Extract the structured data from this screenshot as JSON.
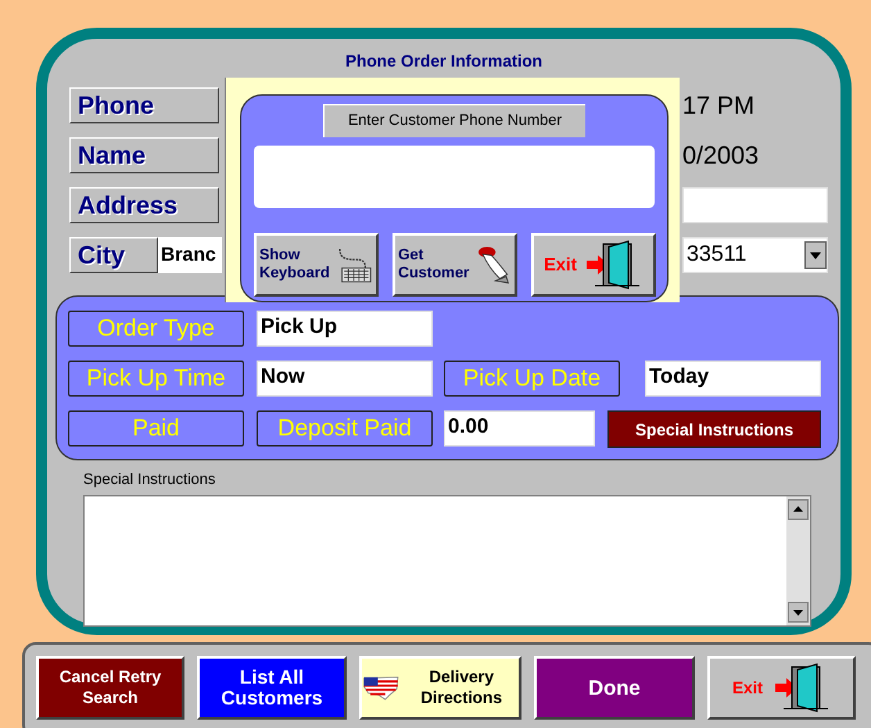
{
  "title": "Phone Order Information",
  "customer_rows": [
    {
      "label": "Phone",
      "side_text": "17 PM"
    },
    {
      "label": "Name",
      "side_text": "0/2003"
    },
    {
      "label": "Address",
      "side_field": ""
    },
    {
      "label": "City",
      "value": "Branc",
      "zip": "33511"
    }
  ],
  "order_rows": [
    [
      {
        "kind": "label",
        "text": "Order Type"
      },
      {
        "kind": "field",
        "text": "Pick Up"
      }
    ],
    [
      {
        "kind": "label",
        "text": "Pick Up Time"
      },
      {
        "kind": "field",
        "text": "Now"
      },
      {
        "kind": "label",
        "text": "Pick Up Date"
      },
      {
        "kind": "field",
        "text": "Today"
      }
    ],
    [
      {
        "kind": "label",
        "text": "Paid"
      },
      {
        "kind": "label",
        "text": "Deposit Paid"
      },
      {
        "kind": "field",
        "text": "0.00"
      },
      {
        "kind": "button",
        "text": "Special Instructions"
      }
    ]
  ],
  "notes": {
    "label": "Special Instructions"
  },
  "popup": {
    "prompt": "Enter Customer Phone Number",
    "buttons": [
      {
        "label": "Show Keyboard",
        "kind": "keyboard"
      },
      {
        "label": "Get Customer",
        "kind": "hand"
      },
      {
        "label": "Exit",
        "kind": "exit"
      }
    ]
  },
  "toolbar": [
    {
      "label": "Cancel Retry Search",
      "kind": "cancel"
    },
    {
      "label": "List All Customers",
      "kind": "list"
    },
    {
      "label": "Delivery Directions",
      "kind": "map"
    },
    {
      "label": "Done",
      "kind": "done"
    },
    {
      "label": "Exit",
      "kind": "exit"
    }
  ]
}
